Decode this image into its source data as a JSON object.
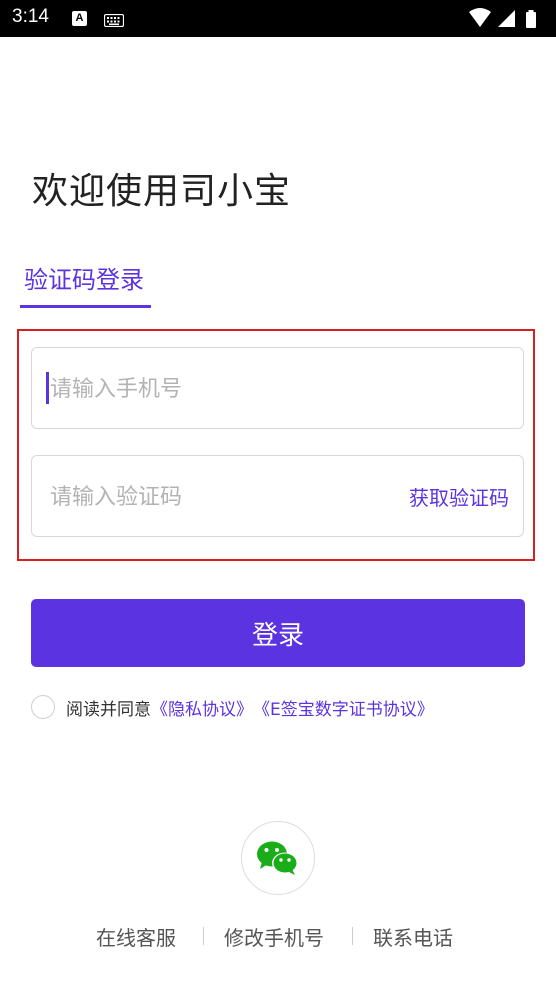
{
  "status_bar": {
    "time": "3:14",
    "notif_letter": "A"
  },
  "header": {
    "welcome_text": "欢迎使用司小宝"
  },
  "tabs": {
    "active_label": "验证码登录"
  },
  "form": {
    "phone_placeholder": "请输入手机号",
    "code_placeholder": "请输入验证码",
    "get_code_label": "获取验证码",
    "login_label": "登录"
  },
  "agreement": {
    "prefix": "阅读并同意",
    "privacy_link": "《隐私协议》",
    "esign_link": "《E签宝数字证书协议》"
  },
  "footer": {
    "links": [
      "在线客服",
      "修改手机号",
      "联系电话"
    ]
  },
  "colors": {
    "accent": "#5b33e0",
    "highlight_border": "#d81e1e",
    "wechat_green": "#1aad19"
  }
}
